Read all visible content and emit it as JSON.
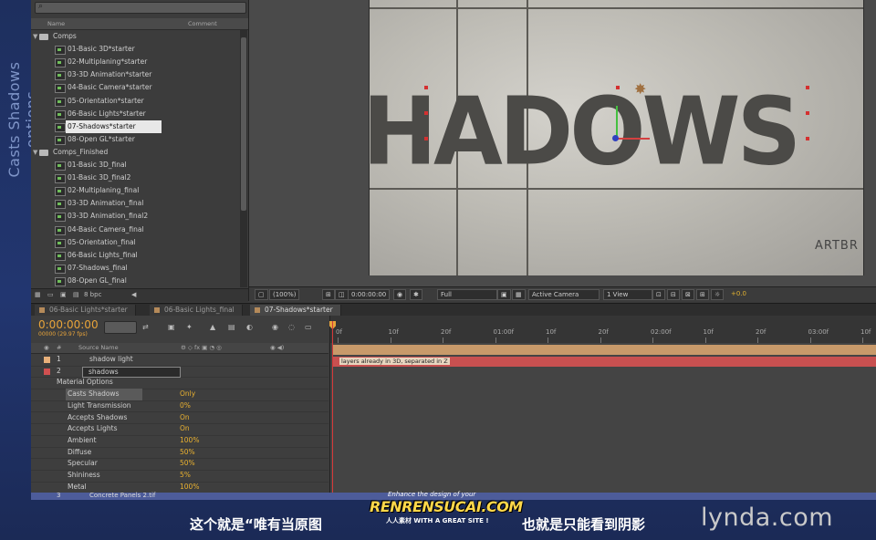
{
  "side_caption": "Casts Shadows options",
  "project": {
    "col_name": "Name",
    "col_comment": "Comment",
    "folders": [
      {
        "label": "Comps",
        "items": [
          "01-Basic 3D*starter",
          "02-Multiplaning*starter",
          "03-3D Animation*starter",
          "04-Basic Camera*starter",
          "05-Orientation*starter",
          "06-Basic Lights*starter",
          "07-Shadows*starter",
          "08-Open GL*starter"
        ]
      },
      {
        "label": "Comps_Finished",
        "items": [
          "01-Basic 3D_final",
          "01-Basic 3D_final2",
          "02-Multiplaning_final",
          "03-3D Animation_final",
          "03-3D Animation_final2",
          "04-Basic Camera_final",
          "05-Orientation_final",
          "06-Basic Lights_final",
          "07-Shadows_final",
          "08-Open GL_final"
        ]
      }
    ],
    "bpc": "8 bpc"
  },
  "viewer": {
    "canvas_word": "HADOWS",
    "brand": "ARTBR",
    "zoom": "(100%)",
    "timecode": "0:00:00:00",
    "resolution": "Full",
    "camera": "Active Camera",
    "views": "1 View",
    "exposure": "+0.0"
  },
  "tabs": [
    "06-Basic Lights*starter",
    "06-Basic Lights_final",
    "07-Shadows*starter"
  ],
  "timeline": {
    "timecode": "0:00:00:00",
    "fps": "00000 (29.97 fps)",
    "col_num": "#",
    "col_source": "Source Name",
    "ruler": [
      "0f",
      "10f",
      "20f",
      "01:00f",
      "10f",
      "20f",
      "02:00f",
      "10f",
      "20f",
      "03:00f",
      "10f"
    ],
    "layers": [
      {
        "num": "1",
        "name": "shadow light",
        "color": "#e8b07a"
      },
      {
        "num": "2",
        "name": "shadows",
        "color": "#d05050"
      }
    ],
    "material_options": "Material Options",
    "properties": [
      {
        "name": "Casts Shadows",
        "value": "Only"
      },
      {
        "name": "Light Transmission",
        "value": "0%"
      },
      {
        "name": "Accepts Shadows",
        "value": "On"
      },
      {
        "name": "Accepts Lights",
        "value": "On"
      },
      {
        "name": "Ambient",
        "value": "100%"
      },
      {
        "name": "Diffuse",
        "value": "50%"
      },
      {
        "name": "Specular",
        "value": "50%"
      },
      {
        "name": "Shininess",
        "value": "5%"
      },
      {
        "name": "Metal",
        "value": "100%"
      }
    ],
    "layer3": {
      "num": "3",
      "name": "Concrete Panels 2.tif"
    },
    "bar_label": "layers already in 3D, separated in Z"
  },
  "subtitle": {
    "line1": "这个就是“唯有当原图",
    "line2": "也就是只能看到阴影",
    "logo": "lynda.com"
  },
  "watermark": {
    "tagline": "Enhance the design of your",
    "brand": "RENRENSUCAI.COM",
    "cn": "人人素材 WITH A GREAT SITE !"
  }
}
